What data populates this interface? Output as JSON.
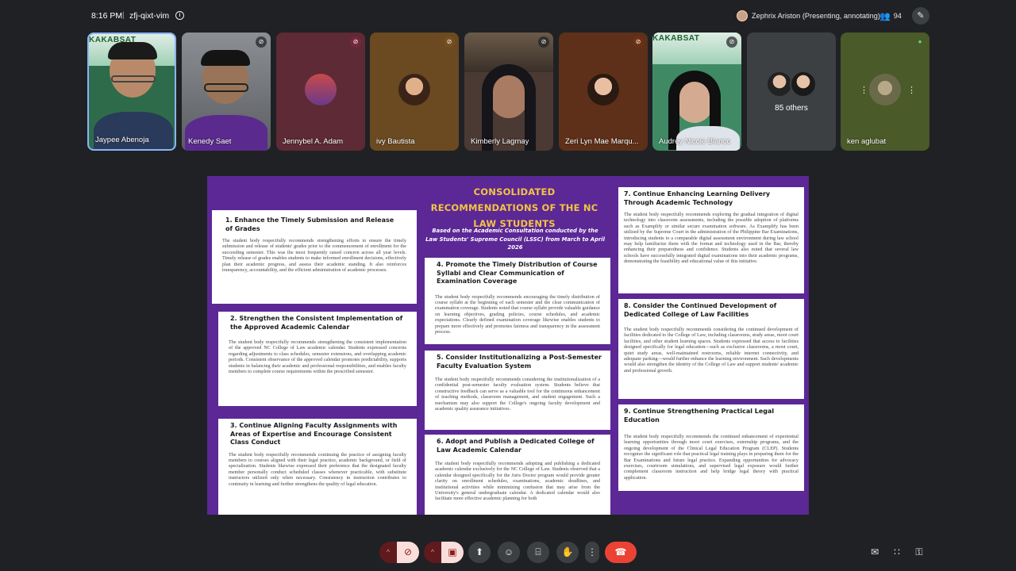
{
  "topbar": {
    "time": "8:16 PM",
    "separator": "|",
    "meeting_code": "zfj-qixt-vim",
    "info_icon": "info-icon",
    "presenter": "Zephrix Ariston (Presenting, annotating)",
    "participant_count": "94"
  },
  "tiles": [
    {
      "name": "Jaypee Abenoja",
      "mic": "active",
      "bg": "#2e6b4b",
      "banner": "KAKABSAT"
    },
    {
      "name": "Kenedy Saet",
      "mic": "muted",
      "bg": "#6b6e74"
    },
    {
      "name": "Jennybel A. Adam",
      "mic": "muted",
      "bg": "#5d2a35"
    },
    {
      "name": "ivy Bautista",
      "mic": "muted",
      "bg": "#6b4a21"
    },
    {
      "name": "Kimberly Lagmay",
      "mic": "muted",
      "bg": "#4a3a33"
    },
    {
      "name": "Zeri Lyn Mae Marqu...",
      "mic": "muted",
      "bg": "#5e3019"
    },
    {
      "name": "Audrey Nicole Blanco",
      "mic": "muted",
      "bg": "#3f8a64",
      "banner": "KAKABSAT"
    },
    {
      "name": "85 others",
      "bg": "#3c4043"
    },
    {
      "name": "ken aglubat",
      "mic": "on",
      "bg": "#4a5a28"
    }
  ],
  "slide": {
    "title": "CONSOLIDATED RECOMMENDATIONS OF THE NC LAW STUDENTS",
    "subtitle": "Based on the Academic Consultation conducted by the Law Students' Supreme Council (LSSC) from March to April 2026",
    "cards": [
      {
        "title": "1. Enhance the Timely Submission and Release of Grades",
        "body": "The student body respectfully recommends strengthening efforts to ensure the timely submission and release of students' grades prior to the commencement of enrollment for the succeeding semester. This was the most frequently raised concern across all year levels. Timely release of grades enables students to make informed enrollment decisions, effectively plan their academic progress, and assess their academic standing. It also reinforces transparency, accountability, and the efficient administration of academic processes."
      },
      {
        "title": "2. Strengthen the Consistent Implementation of the Approved Academic Calendar",
        "body": "The student body respectfully recommends strengthening the consistent implementation of the approved NC College of Law academic calendar. Students expressed concerns regarding adjustments to class schedules, semester extensions, and overlapping academic periods. Consistent observance of the approved calendar promotes predictability, supports students in balancing their academic and professional responsibilities, and enables faculty members to complete course requirements within the prescribed semester."
      },
      {
        "title": "3. Continue Aligning Faculty Assignments with Areas of Expertise and Encourage Consistent Class Conduct",
        "body": "The student body respectfully recommends continuing the practice of assigning faculty members to courses aligned with their legal practice, academic background, or field of specialization. Students likewise expressed their preference that the designated faculty member personally conduct scheduled classes whenever practicable, with substitute instructors utilized only when necessary. Consistency in instruction contributes to continuity in learning and further strengthens the quality of legal education."
      },
      {
        "title": "4. Promote the Timely Distribution of Course Syllabi and Clear Communication of Examination Coverage",
        "body": "The student body respectfully recommends encouraging the timely distribution of course syllabi at the beginning of each semester and the clear communication of examination coverage. Students noted that course syllabi provide valuable guidance on learning objectives, grading policies, course schedules, and academic expectations. Clearly defined examination coverage likewise enables students to prepare more effectively and promotes fairness and transparency in the assessment process."
      },
      {
        "title": "5. Consider Institutionalizing a Post-Semester Faculty Evaluation System",
        "body": "The student body respectfully recommends considering the institutionalization of a confidential post-semester faculty evaluation system. Students believe that constructive feedback can serve as a valuable tool for the continuous enhancement of teaching methods, classroom management, and student engagement. Such a mechanism may also support the College's ongoing faculty development and academic quality assurance initiatives."
      },
      {
        "title": "6. Adopt and Publish a Dedicated College of Law Academic Calendar",
        "body": "The student body respectfully recommends adopting and publishing a dedicated academic calendar exclusively for the NC College of Law. Students observed that a calendar designed specifically for the Juris Doctor program would provide greater clarity on enrollment schedules, examinations, academic deadlines, and institutional activities while minimizing confusion that may arise from the University's general undergraduate calendar. A dedicated calendar would also facilitate more effective academic planning for both"
      },
      {
        "title": "7. Continue Enhancing Learning Delivery Through Academic Technology",
        "body": "The student body respectfully recommends exploring the gradual integration of digital technology into classroom assessments, including the possible adoption of platforms such as Examplify or similar secure examination software. As Examplify has been utilized by the Supreme Court in the administration of the Philippine Bar Examinations, introducing students to a comparable digital assessment environment during law school may help familiarize them with the format and technology used in the Bar, thereby enhancing their preparedness and confidence. Students also noted that several law schools have successfully integrated digital examinations into their academic programs, demonstrating the feasibility and educational value of this initiative."
      },
      {
        "title": "8. Consider the Continued Development of Dedicated College of Law Facilities",
        "body": "The student body respectfully recommends considering the continued development of facilities dedicated to the College of Law, including classrooms, study areas, moot court facilities, and other student learning spaces. Students expressed that access to facilities designed specifically for legal education—such as exclusive classrooms, a moot court, quiet study areas, well-maintained restrooms, reliable internet connectivity, and adequate parking—would further enhance the learning environment. Such developments would also strengthen the identity of the College of Law and support students' academic and professional growth."
      },
      {
        "title": "9. Continue Strengthening Practical Legal Education",
        "body": "The student body respectfully recommends the continued enhancement of experiential learning opportunities through moot court exercises, externship programs, and the ongoing development of the Clinical Legal Education Program (CLEP). Students recognize the significant role that practical legal training plays in preparing them for the Bar Examinations and future legal practice. Expanding opportunities for advocacy exercises, courtroom simulations, and supervised legal exposure would further complement classroom instruction and help bridge legal theory with practical application."
      }
    ]
  },
  "controls": {
    "chevron": "^",
    "mic": "🎙",
    "camera": "▣",
    "present": "⬆",
    "emoji": "☺",
    "captions": "⌸",
    "hand": "✋",
    "more": "⋮",
    "hangup": "☎",
    "chat": "✉",
    "activities": "∷",
    "host": "⚿"
  },
  "colors": {
    "slide_bg": "#5b2896",
    "title_gold": "#f3c443",
    "active_border": "#8ab4f8",
    "hangup_red": "#ea4335"
  }
}
